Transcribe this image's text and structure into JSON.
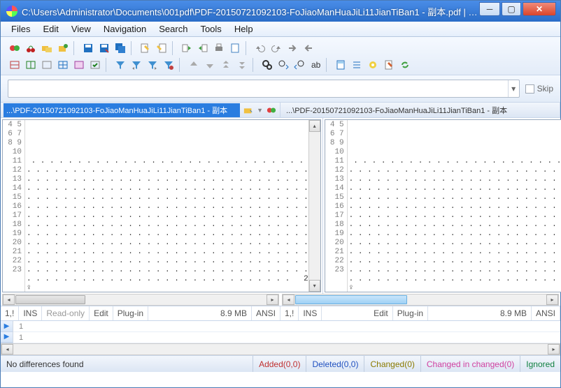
{
  "title": "C:\\Users\\Administrator\\Documents\\001pdf\\PDF-20150721092103-FoJiaoManHuaJiLi11JianTiBan1 - 副本.pdf | C...",
  "menu": [
    "Files",
    "Edit",
    "View",
    "Navigation",
    "Search",
    "Tools",
    "Help"
  ],
  "skip_label": "Skip",
  "tabs": {
    "left": "...\\PDF-20150721092103-FoJiaoManHuaJiLi11JianTiBan1 - 副本",
    "right": "...\\PDF-20150721092103-FoJiaoManHuaJiLi11JianTiBan1 - 副本"
  },
  "line_start": 4,
  "line_end": 23,
  "content_lines": [
    "",
    "",
    "",
    "",
    " . . . . . . . . . . . . . . . . . . . . . . . . . . . . . .",
    ". . . . . . . . . . . . . . . . . . . . . . . . . . . . . . .",
    ". . . . . . . . . . . . . . . . . . . . . . . . . . . . . . .",
    ". . . . . . . . . . . . . . . . . . . . . . . . . . . . . . .",
    ". . . . . . . . . . . . . . . . . . . . . . . . . . . . . . .",
    ". . . . . . . . . . . . . . . . . . . . . . . . . . . . . . .",
    ". . . . . . . . . . . . . . . . . . . . . . . . . . . . . . .",
    ". . . . . . . . . . . . . . . . . . . . . . . . . . . . . . .",
    ". . . . . . . . . . . . . . . . . . . . . . . . . . . . . . .",
    ". . . . . . . . . . . . . . . . . . . . . . . . . . . . . . .",
    ". . . . . . . . . . . . . . . . . . . . . . . . . . . . . . .",
    ". . . . . . . . . . . . . . . . . . . . . . . . . . . . . . .",
    ". . . . . . . . . . . . . . . . . . . . . . . . . . . . . . .",
    ". . . . . . . . . . . . . . . . . . . . . . . . . . . . .   2",
    "♀",
    ""
  ],
  "status_pane": {
    "pos": "1,!",
    "ins": "INS",
    "ro": "Read-only",
    "edit": "Edit",
    "plugin": "Plug-in",
    "size": "8.9 MB",
    "enc": "ANSI"
  },
  "diffnav": {
    "row1": "1",
    "row2": "1"
  },
  "statusbar": {
    "msg": "No differences found",
    "added": "Added(0,0)",
    "deleted": "Deleted(0,0)",
    "changed": "Changed(0)",
    "cic": "Changed in changed(0)",
    "ignored": "Ignored"
  }
}
